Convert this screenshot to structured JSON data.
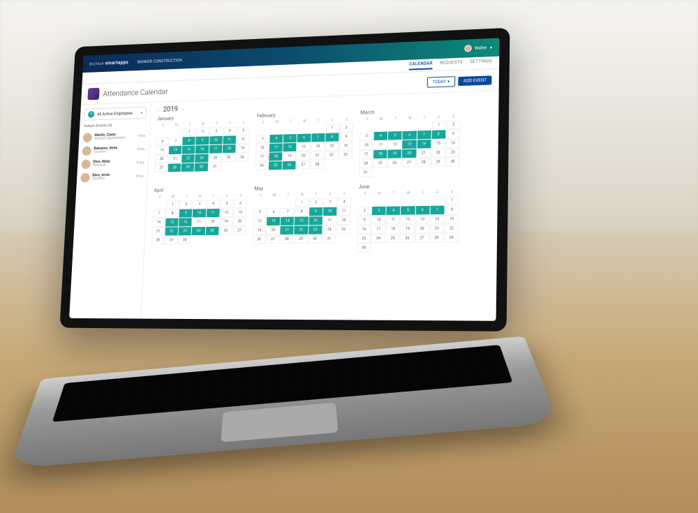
{
  "brand": {
    "name": "smart",
    "suffix": "apps",
    "prefix": "BizTech"
  },
  "breadcrumb": "BANKER CONSTRUCTION",
  "user": {
    "name": "Walter"
  },
  "tabs": [
    {
      "label": "CALENDAR",
      "active": true
    },
    {
      "label": "REQUESTS",
      "active": false
    },
    {
      "label": "SETTINGS",
      "active": false
    }
  ],
  "page": {
    "title": "Attendance Calendar"
  },
  "buttons": {
    "today": "TODAY",
    "add_event": "ADD EVENT"
  },
  "sidebar": {
    "filter_label": "All Active Employees",
    "section_label": "Today's Events (4)",
    "events": [
      {
        "name": "Martin, Caste",
        "type": "Doctors Appointment",
        "dur": "4 hrs"
      },
      {
        "name": "Balsamo, Delia",
        "type": "Vacation",
        "dur": "8 hrs"
      },
      {
        "name": "Ehrn, Niels",
        "type": "Personal",
        "dur": "8 hrs"
      },
      {
        "name": "Baro, Arvin",
        "type": "Vacation",
        "dur": "8 hrs"
      }
    ]
  },
  "year": "2019",
  "dow": [
    "S",
    "M",
    "T",
    "W",
    "T",
    "F",
    "S"
  ],
  "months": [
    {
      "name": "January",
      "start": 2,
      "days": 31,
      "hl": [
        8,
        9,
        10,
        11,
        14,
        15,
        16,
        17,
        18,
        22,
        23,
        28,
        29,
        30
      ]
    },
    {
      "name": "February",
      "start": 5,
      "days": 28,
      "hl": [
        4,
        5,
        6,
        7,
        8,
        11,
        12,
        18,
        25,
        26
      ]
    },
    {
      "name": "March",
      "start": 5,
      "days": 31,
      "hl": [
        4,
        5,
        6,
        7,
        8,
        13,
        14,
        18,
        19,
        20
      ]
    },
    {
      "name": "April",
      "start": 1,
      "days": 30,
      "hl": [
        9,
        10,
        11,
        15,
        16,
        22,
        23,
        24,
        25
      ]
    },
    {
      "name": "May",
      "start": 3,
      "days": 31,
      "hl": [
        9,
        10,
        13,
        14,
        15,
        16,
        21,
        22,
        23
      ]
    },
    {
      "name": "June",
      "start": 6,
      "days": 30,
      "hl": [
        3,
        4,
        5,
        6,
        7
      ]
    }
  ]
}
